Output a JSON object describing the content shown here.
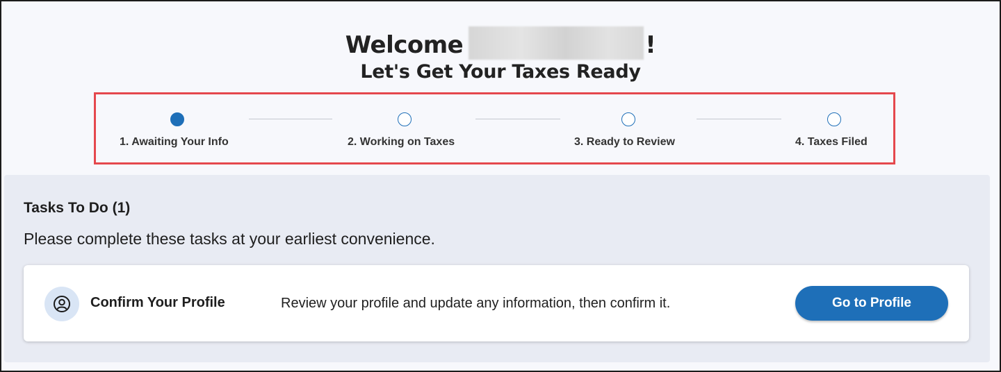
{
  "header": {
    "welcome_prefix": "Welcome",
    "welcome_suffix": "!",
    "subtitle": "Let's Get Your Taxes Ready"
  },
  "stepper": {
    "steps": [
      {
        "label": "1.  Awaiting Your Info",
        "active": true
      },
      {
        "label": "2.  Working on Taxes",
        "active": false
      },
      {
        "label": "3.  Ready to Review",
        "active": false
      },
      {
        "label": "4.  Taxes Filed",
        "active": false
      }
    ]
  },
  "tasks": {
    "title": "Tasks To Do (1)",
    "description": "Please complete these tasks at your earliest convenience.",
    "items": [
      {
        "icon": "user-circle-icon",
        "name": "Confirm Your Profile",
        "text": "Review your profile and update any information, then confirm it.",
        "button_label": "Go to Profile"
      }
    ]
  },
  "colors": {
    "accent": "#1e6fb8",
    "highlight_border": "#e5484d",
    "panel_bg": "#e8ebf3"
  }
}
